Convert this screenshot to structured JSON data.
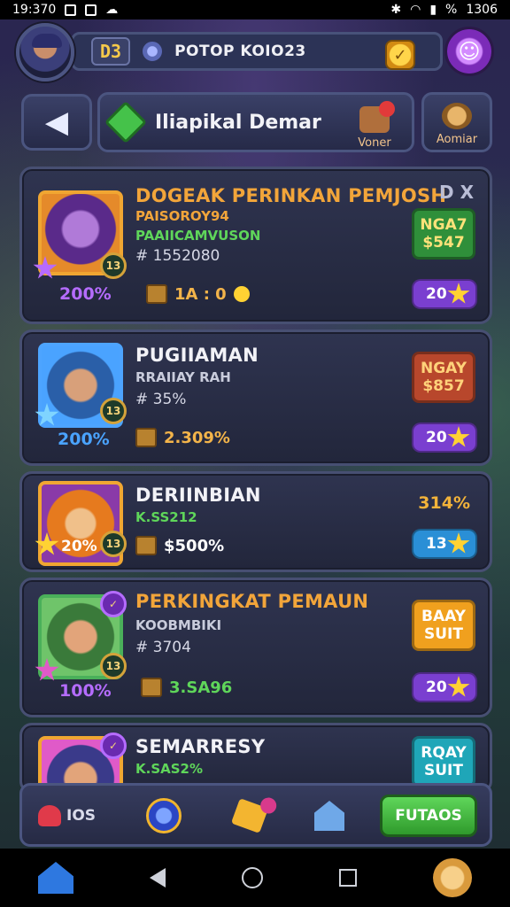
{
  "status_bar": {
    "time_left": "19:370",
    "time_right": "1306"
  },
  "top_bar": {
    "level": "D3",
    "resource_text": "POTOP KOIO23",
    "coin_icon": "coin-icon",
    "profile_icon": "ghost-icon"
  },
  "header": {
    "back_icon": "back-arrow-icon",
    "title": "Iliapikal Demar",
    "money_label": "Voner",
    "avatar_label": "Aomiar"
  },
  "players": [
    {
      "name": "DOGEAK PERINKAN PEMJOSH",
      "name_color": "#f2a53a",
      "sub1": "PAISOROY94",
      "sub1_color": "#f2a53a",
      "sub2_a": "PAAIICAMVUSON",
      "sub2": "# 1552080",
      "percent": "200%",
      "percent_color": "#b56cff",
      "resource": "1A : 0",
      "price_line1": "NGA7",
      "price_line2": "$547",
      "price_color": "#2f8f3a",
      "price_text_color": "#ffe27a",
      "rank": "20",
      "rank_color": "#7a3fd0",
      "close": "D X",
      "level_badge": "13"
    },
    {
      "name": "PUGIIAMAN",
      "name_color": "#f2f2f7",
      "sub1": "RRAIIAY RAH",
      "sub1_color": "#c9ccdc",
      "sub2": "# 35%",
      "percent": "200%",
      "percent_color": "#4aa3ff",
      "resource": "2.309%",
      "price_line1": "NGAY",
      "price_line2": "$857",
      "price_color": "#b8472c",
      "price_text_color": "#ffd27a",
      "rank": "20",
      "rank_color": "#7a3fd0",
      "level_badge": "13"
    },
    {
      "name": "DERIINBIAN",
      "name_color": "#f2f2f7",
      "sub1": "K.SS212",
      "sub1_color": "#5fd65a",
      "percent": "20%",
      "percent_color": "#ffffff",
      "resource": "$500%",
      "price_plain": "314%",
      "price_plain_color": "#f2b33a",
      "rank": "13",
      "rank_color": "#2a8fd6",
      "level_badge": "13"
    },
    {
      "name": "PERKINGKAT PEMAUN",
      "name_color": "#f2a53a",
      "sub1": "KOOBMBIKI",
      "sub1_color": "#c9ccdc",
      "sub2": "# 3704",
      "percent": "100%",
      "percent_color": "#b56cff",
      "resource": "3.SA96",
      "resource_color": "#5fd65a",
      "price_line1": "BAAY",
      "price_line2": "SUIT",
      "price_color": "#f0a01e",
      "price_text_color": "#ffffff",
      "rank": "20",
      "rank_color": "#7a3fd0",
      "level_badge": "13"
    },
    {
      "name": "SEMARRESY",
      "name_color": "#f2f2f7",
      "sub1": "K.SAS2%",
      "sub1_color": "#5fd65a",
      "price_line1": "RQAY",
      "price_line2": "SUIT",
      "price_color": "#1fa6b8",
      "price_text_color": "#ffffff"
    }
  ],
  "bottom_bar": {
    "hearts_text": "IOS",
    "action_label": "FUTAOS"
  },
  "colors": {
    "panel": "#2f3450",
    "panel_border": "#474f72",
    "accent_gold": "#f2a53a",
    "accent_green": "#5fd65a"
  }
}
